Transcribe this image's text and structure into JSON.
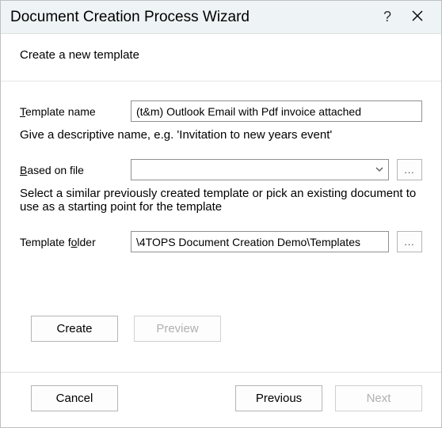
{
  "window": {
    "title": "Document Creation Process Wizard",
    "help": "?",
    "subheader": "Create a new template"
  },
  "form": {
    "template_name": {
      "label_pre": "T",
      "label_rest": "emplate name",
      "value": "(t&m) Outlook Email with Pdf invoice attached",
      "hint": "Give a descriptive name, e.g. 'Invitation to new years event'"
    },
    "based_on": {
      "label_pre": "B",
      "label_rest": "ased on file",
      "value": "",
      "hint": "Select a similar previously created template or pick an existing document to use as a starting point for the template",
      "browse": "..."
    },
    "template_folder": {
      "label_before_o": "Template f",
      "label_o": "o",
      "label_after_o": "lder",
      "value": "\\4TOPS Document Creation Demo\\Templates",
      "browse": "..."
    }
  },
  "buttons": {
    "create": "Create",
    "preview": "Preview",
    "cancel": "Cancel",
    "previous": "Previous",
    "next": "Next"
  }
}
